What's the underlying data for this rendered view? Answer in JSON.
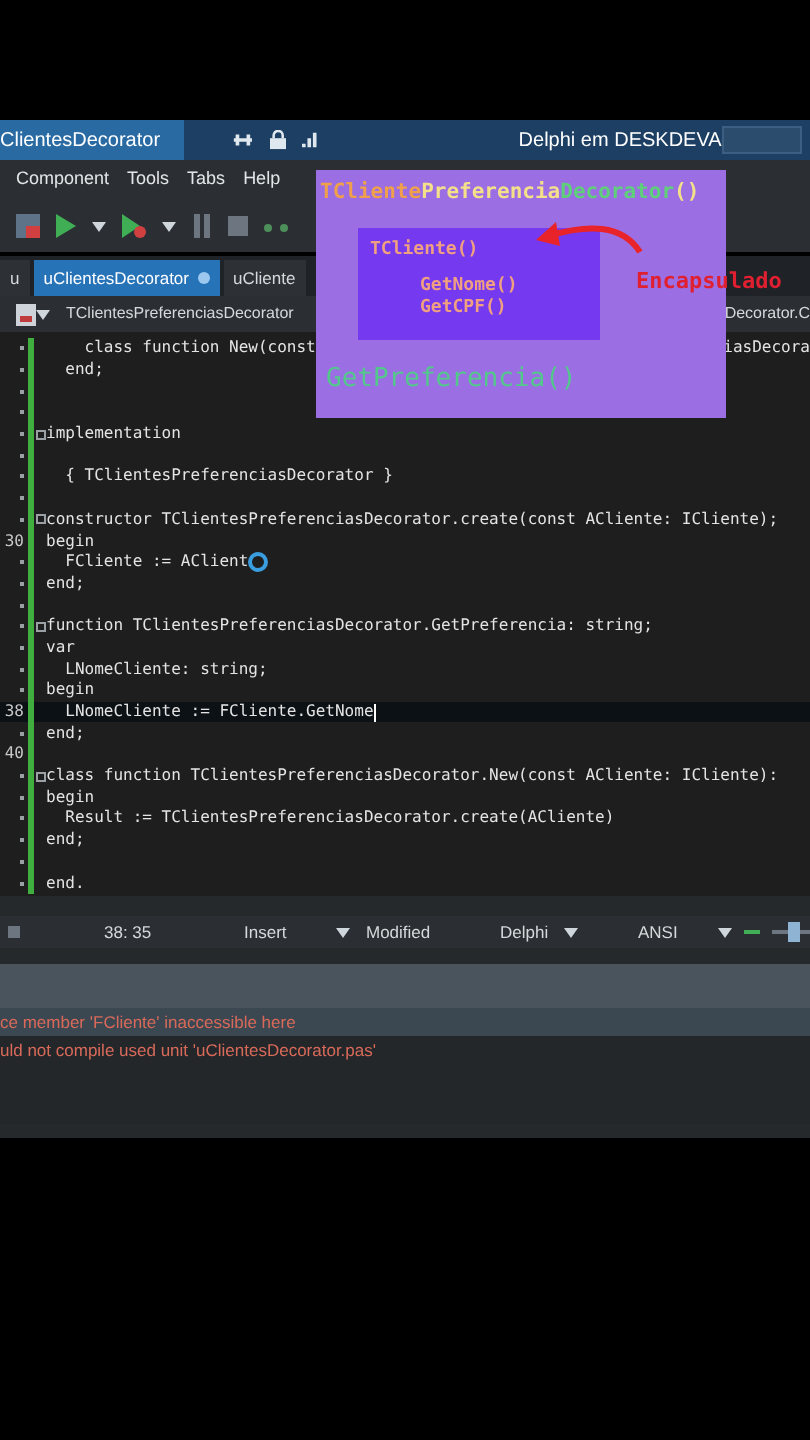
{
  "title_bar": {
    "project_tab": "ClientesDecorator",
    "title": "Delphi em DESKDEVA"
  },
  "menu": [
    "Component",
    "Tools",
    "Tabs",
    "Help"
  ],
  "editor_tabs": [
    {
      "label": "u",
      "selected": false,
      "modified": false
    },
    {
      "label": "uClientesDecorator",
      "selected": true,
      "modified": true
    },
    {
      "label": "uCliente",
      "selected": false,
      "modified": false
    }
  ],
  "breadcrumb": {
    "left": "TClientesPreferenciasDecorator",
    "right": "Decorator.C"
  },
  "code_lines": [
    {
      "kind": "code",
      "text": "    class function New(const",
      "tail": "iasDecora"
    },
    {
      "kind": "code",
      "text": "  end;"
    },
    {
      "kind": "blank"
    },
    {
      "kind": "blank"
    },
    {
      "kind": "code",
      "text": "implementation",
      "fold": true
    },
    {
      "kind": "blank"
    },
    {
      "kind": "code",
      "text": "  { TClientesPreferenciasDecorator }"
    },
    {
      "kind": "blank"
    },
    {
      "kind": "code",
      "text": "constructor TClientesPreferenciasDecorator.create(const ACliente: ICliente);",
      "fold": true
    },
    {
      "kind": "code",
      "number": "30",
      "text": "begin"
    },
    {
      "kind": "code",
      "text": "  FCliente := AClient",
      "pointer": true
    },
    {
      "kind": "code",
      "text": "end;"
    },
    {
      "kind": "blank"
    },
    {
      "kind": "code",
      "text": "function TClientesPreferenciasDecorator.GetPreferencia: string;",
      "fold": true
    },
    {
      "kind": "code",
      "text": "var"
    },
    {
      "kind": "code",
      "text": "  LNomeCliente: string;"
    },
    {
      "kind": "code",
      "text": "begin"
    },
    {
      "kind": "code",
      "number": "38",
      "text": "  LNomeCliente := FCliente.GetNome",
      "current": true
    },
    {
      "kind": "code",
      "text": "end;"
    },
    {
      "kind": "blank",
      "number": "40"
    },
    {
      "kind": "code",
      "text": "class function TClientesPreferenciasDecorator.New(const ACliente: ICliente):",
      "fold": true
    },
    {
      "kind": "code",
      "text": "begin"
    },
    {
      "kind": "code",
      "text": "  Result := TClientesPreferenciasDecorator.create(ACliente)"
    },
    {
      "kind": "code",
      "text": "end;"
    },
    {
      "kind": "blank"
    },
    {
      "kind": "code",
      "text": "end."
    }
  ],
  "status_bar": {
    "position": "38: 35",
    "mode": "Insert",
    "state": "Modified",
    "language": "Delphi",
    "encoding": "ANSI",
    "zoom": {
      "level": 0.6
    }
  },
  "messages": [
    {
      "text": "ce member 'FCliente' inaccessible here",
      "selected": true
    },
    {
      "text": "uld not compile used unit 'uClientesDecorator.pas'",
      "selected": false
    }
  ],
  "overlay": {
    "title": [
      {
        "text": "TCliente",
        "color": "#f0a04a"
      },
      {
        "text": "Preferencia",
        "color": "#f5e08a"
      },
      {
        "text": "Decorator",
        "color": "#5fd07a"
      },
      {
        "text": "()",
        "color": "#f5e08a"
      }
    ],
    "inner_title": "TCliente()",
    "methods": [
      "GetNome()",
      "GetCPF()"
    ],
    "outer_method": "GetPreferencia()",
    "callout": "Encapsulado"
  }
}
